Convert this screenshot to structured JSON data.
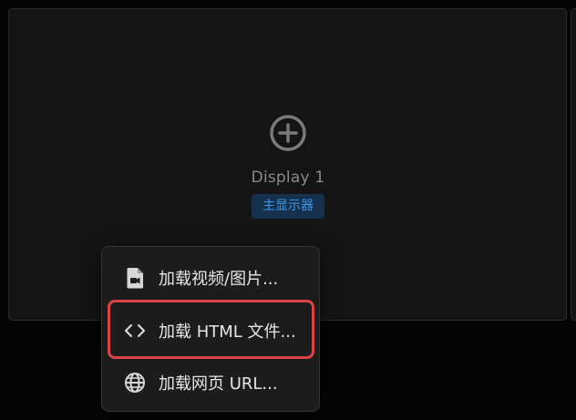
{
  "display": {
    "name": "Display 1",
    "badge": "主显示器"
  },
  "menu": {
    "items": [
      {
        "label": "加载视频/图片...",
        "icon": "file-media-icon"
      },
      {
        "label": "加载 HTML 文件...",
        "icon": "code-icon"
      },
      {
        "label": "加载网页 URL...",
        "icon": "globe-icon"
      }
    ]
  },
  "colors": {
    "background": "#050505",
    "panel": "#141414",
    "badge_bg": "#14304c",
    "badge_text": "#3d98e8",
    "highlight": "#d94343",
    "menu_bg": "#1c1c1c"
  }
}
